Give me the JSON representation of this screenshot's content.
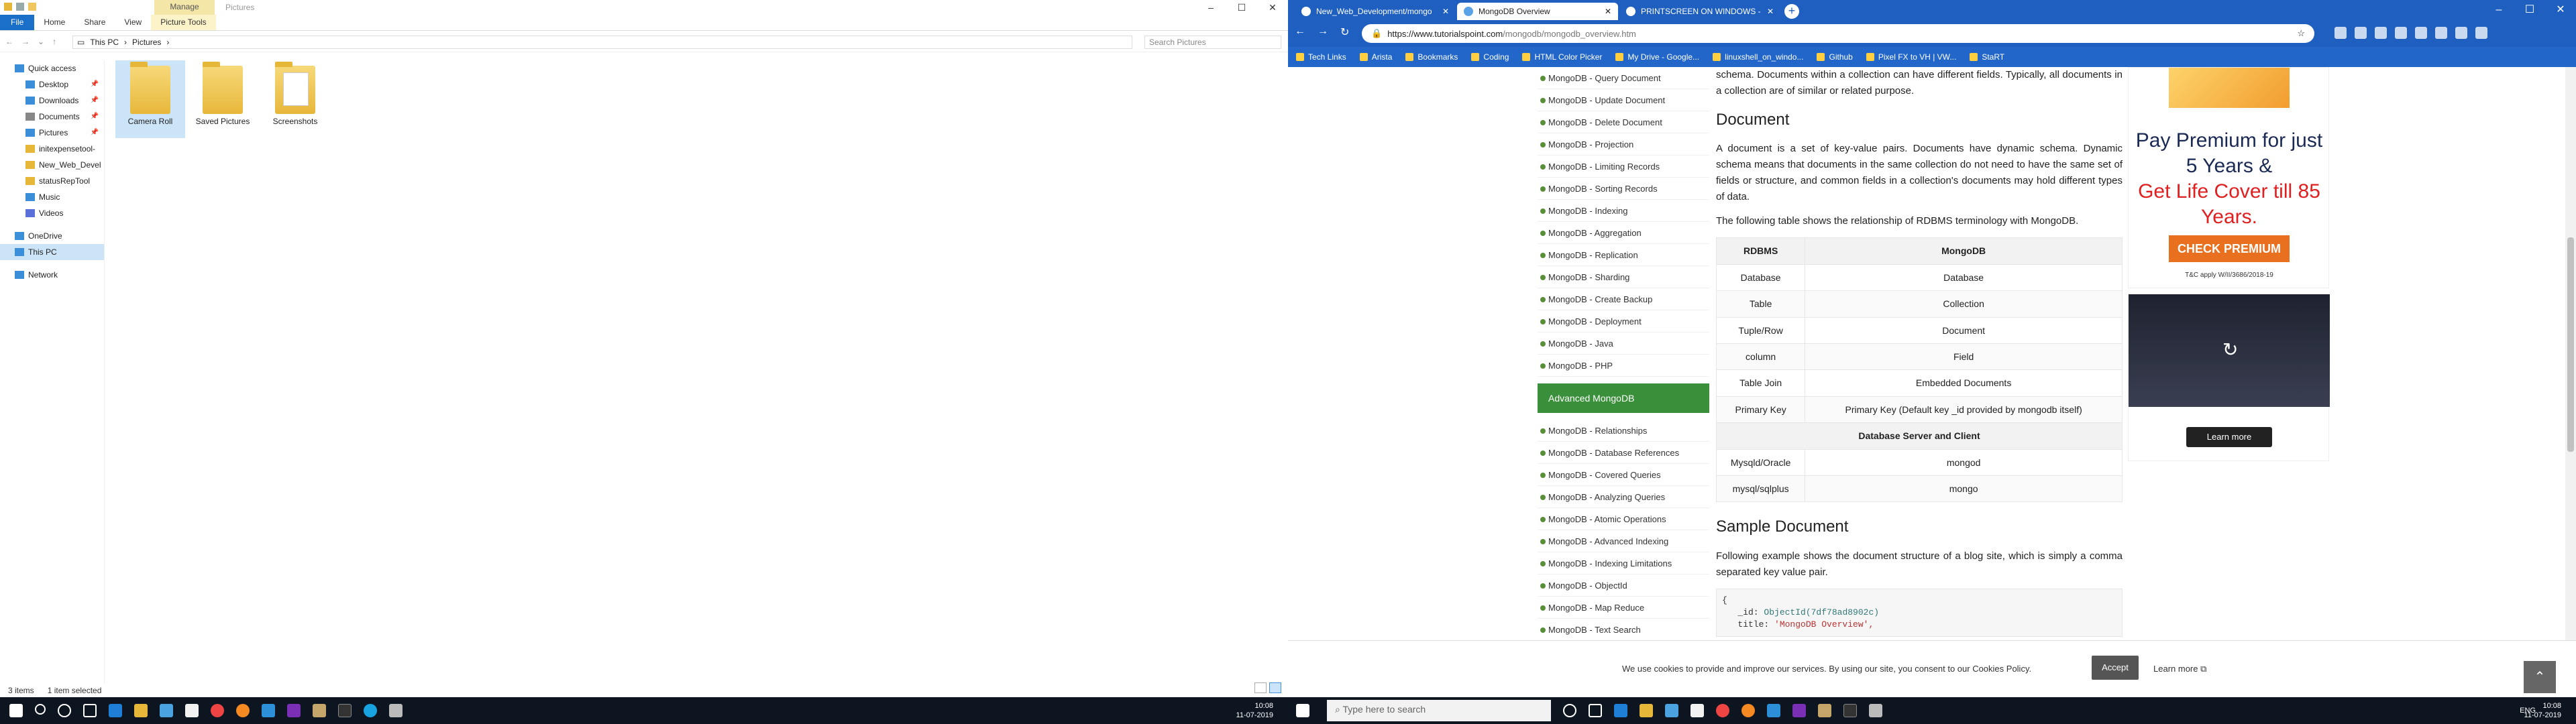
{
  "explorer": {
    "manage_tab": "Manage",
    "title": "Pictures",
    "ribbon_tabs": [
      "File",
      "Home",
      "Share",
      "View",
      "Picture Tools"
    ],
    "breadcrumb": [
      "This PC",
      "Pictures"
    ],
    "search_placeholder": "Search Pictures",
    "nav": [
      {
        "label": "Quick access",
        "sub": false,
        "pin": false
      },
      {
        "label": "Desktop",
        "sub": true,
        "pin": true
      },
      {
        "label": "Downloads",
        "sub": true,
        "pin": true
      },
      {
        "label": "Documents",
        "sub": true,
        "pin": true
      },
      {
        "label": "Pictures",
        "sub": true,
        "pin": true
      },
      {
        "label": "initexpensetool-",
        "sub": true,
        "pin": false
      },
      {
        "label": "New_Web_Devel",
        "sub": true,
        "pin": false
      },
      {
        "label": "statusRepTool",
        "sub": true,
        "pin": false
      },
      {
        "label": "Music",
        "sub": true,
        "pin": false
      },
      {
        "label": "Videos",
        "sub": true,
        "pin": false
      },
      {
        "label": "OneDrive",
        "sub": false,
        "pin": false
      },
      {
        "label": "This PC",
        "sub": false,
        "pin": false
      },
      {
        "label": "Network",
        "sub": false,
        "pin": false
      }
    ],
    "folders": [
      {
        "label": "Camera Roll",
        "selected": true,
        "photo": false
      },
      {
        "label": "Saved Pictures",
        "selected": false,
        "photo": false
      },
      {
        "label": "Screenshots",
        "selected": false,
        "photo": true
      }
    ],
    "status": {
      "count": "3 items",
      "selected": "1 item selected"
    }
  },
  "chrome": {
    "tabs": [
      {
        "label": "New_Web_Development/mongo",
        "active": false
      },
      {
        "label": "MongoDB Overview",
        "active": true
      },
      {
        "label": "PRINTSCREEN ON WINDOWS -",
        "active": false
      }
    ],
    "url_host": "https://www.tutorialspoint.com",
    "url_path": "/mongodb/mongodb_overview.htm",
    "bookmarks": [
      "Tech Links",
      "Arista",
      "Bookmarks",
      "Coding",
      "HTML Color Picker",
      "My Drive - Google...",
      "linuxshell_on_windo...",
      "Github",
      "Pixel FX to VH | VW...",
      "StaRT"
    ]
  },
  "page": {
    "sidebar_top": [
      "MongoDB - Query Document",
      "MongoDB - Update Document",
      "MongoDB - Delete Document",
      "MongoDB - Projection",
      "MongoDB - Limiting Records",
      "MongoDB - Sorting Records",
      "MongoDB - Indexing",
      "MongoDB - Aggregation",
      "MongoDB - Replication",
      "MongoDB - Sharding",
      "MongoDB - Create Backup",
      "MongoDB - Deployment",
      "MongoDB - Java",
      "MongoDB - PHP"
    ],
    "sidebar_head": "Advanced MongoDB",
    "sidebar_bottom": [
      "MongoDB - Relationships",
      "MongoDB - Database References",
      "MongoDB - Covered Queries",
      "MongoDB - Analyzing Queries",
      "MongoDB - Atomic Operations",
      "MongoDB - Advanced Indexing",
      "MongoDB - Indexing Limitations",
      "MongoDB - ObjectId",
      "MongoDB - Map Reduce",
      "MongoDB - Text Search"
    ],
    "para_intro": "schema. Documents within a collection can have different fields. Typically, all documents in a collection are of similar or related purpose.",
    "h_document": "Document",
    "para_document": "A document is a set of key-value pairs. Documents have dynamic schema. Dynamic schema means that documents in the same collection do not need to have the same set of fields or structure, and common fields in a collection's documents may hold different types of data.",
    "para_table": "The following table shows the relationship of RDBMS terminology with MongoDB.",
    "table_head": [
      "RDBMS",
      "MongoDB"
    ],
    "table_rows": [
      [
        "Database",
        "Database"
      ],
      [
        "Table",
        "Collection"
      ],
      [
        "Tuple/Row",
        "Document"
      ],
      [
        "column",
        "Field"
      ],
      [
        "Table Join",
        "Embedded Documents"
      ],
      [
        "Primary Key",
        "Primary Key (Default key _id provided by mongodb itself)"
      ]
    ],
    "table_subhead": "Database Server and Client",
    "table_rows2": [
      [
        "Mysqld/Oracle",
        "mongod"
      ],
      [
        "mysql/sqlplus",
        "mongo"
      ]
    ],
    "h_sample": "Sample Document",
    "para_sample": "Following example shows the document structure of a blog site, which is simply a comma separated key value pair.",
    "code_l1": "{",
    "code_l2_key": "   _id: ",
    "code_l2_val": "ObjectId(7df78ad8902c)",
    "code_l3_key": "   title: ",
    "code_l3_val": "'MongoDB Overview',"
  },
  "ad": {
    "headline": "Pay Premium for just 5 Years &",
    "highlight": "Get Life Cover till 85 Years.",
    "cta": "CHECK PREMIUM",
    "fine": "T&C apply W/II/3686/2018-19",
    "learn": "Learn more"
  },
  "cookie": {
    "message": "We use cookies to provide and improve our services. By using our site, you consent to our Cookies Policy.",
    "accept": "Accept",
    "learn": "Learn more"
  },
  "taskbar_left": {
    "time": "10:08",
    "date": "11-07-2019"
  },
  "taskbar_right": {
    "search": "Type here to search",
    "lang": "ENG",
    "time": "10:08",
    "date": "11-07-2019"
  }
}
